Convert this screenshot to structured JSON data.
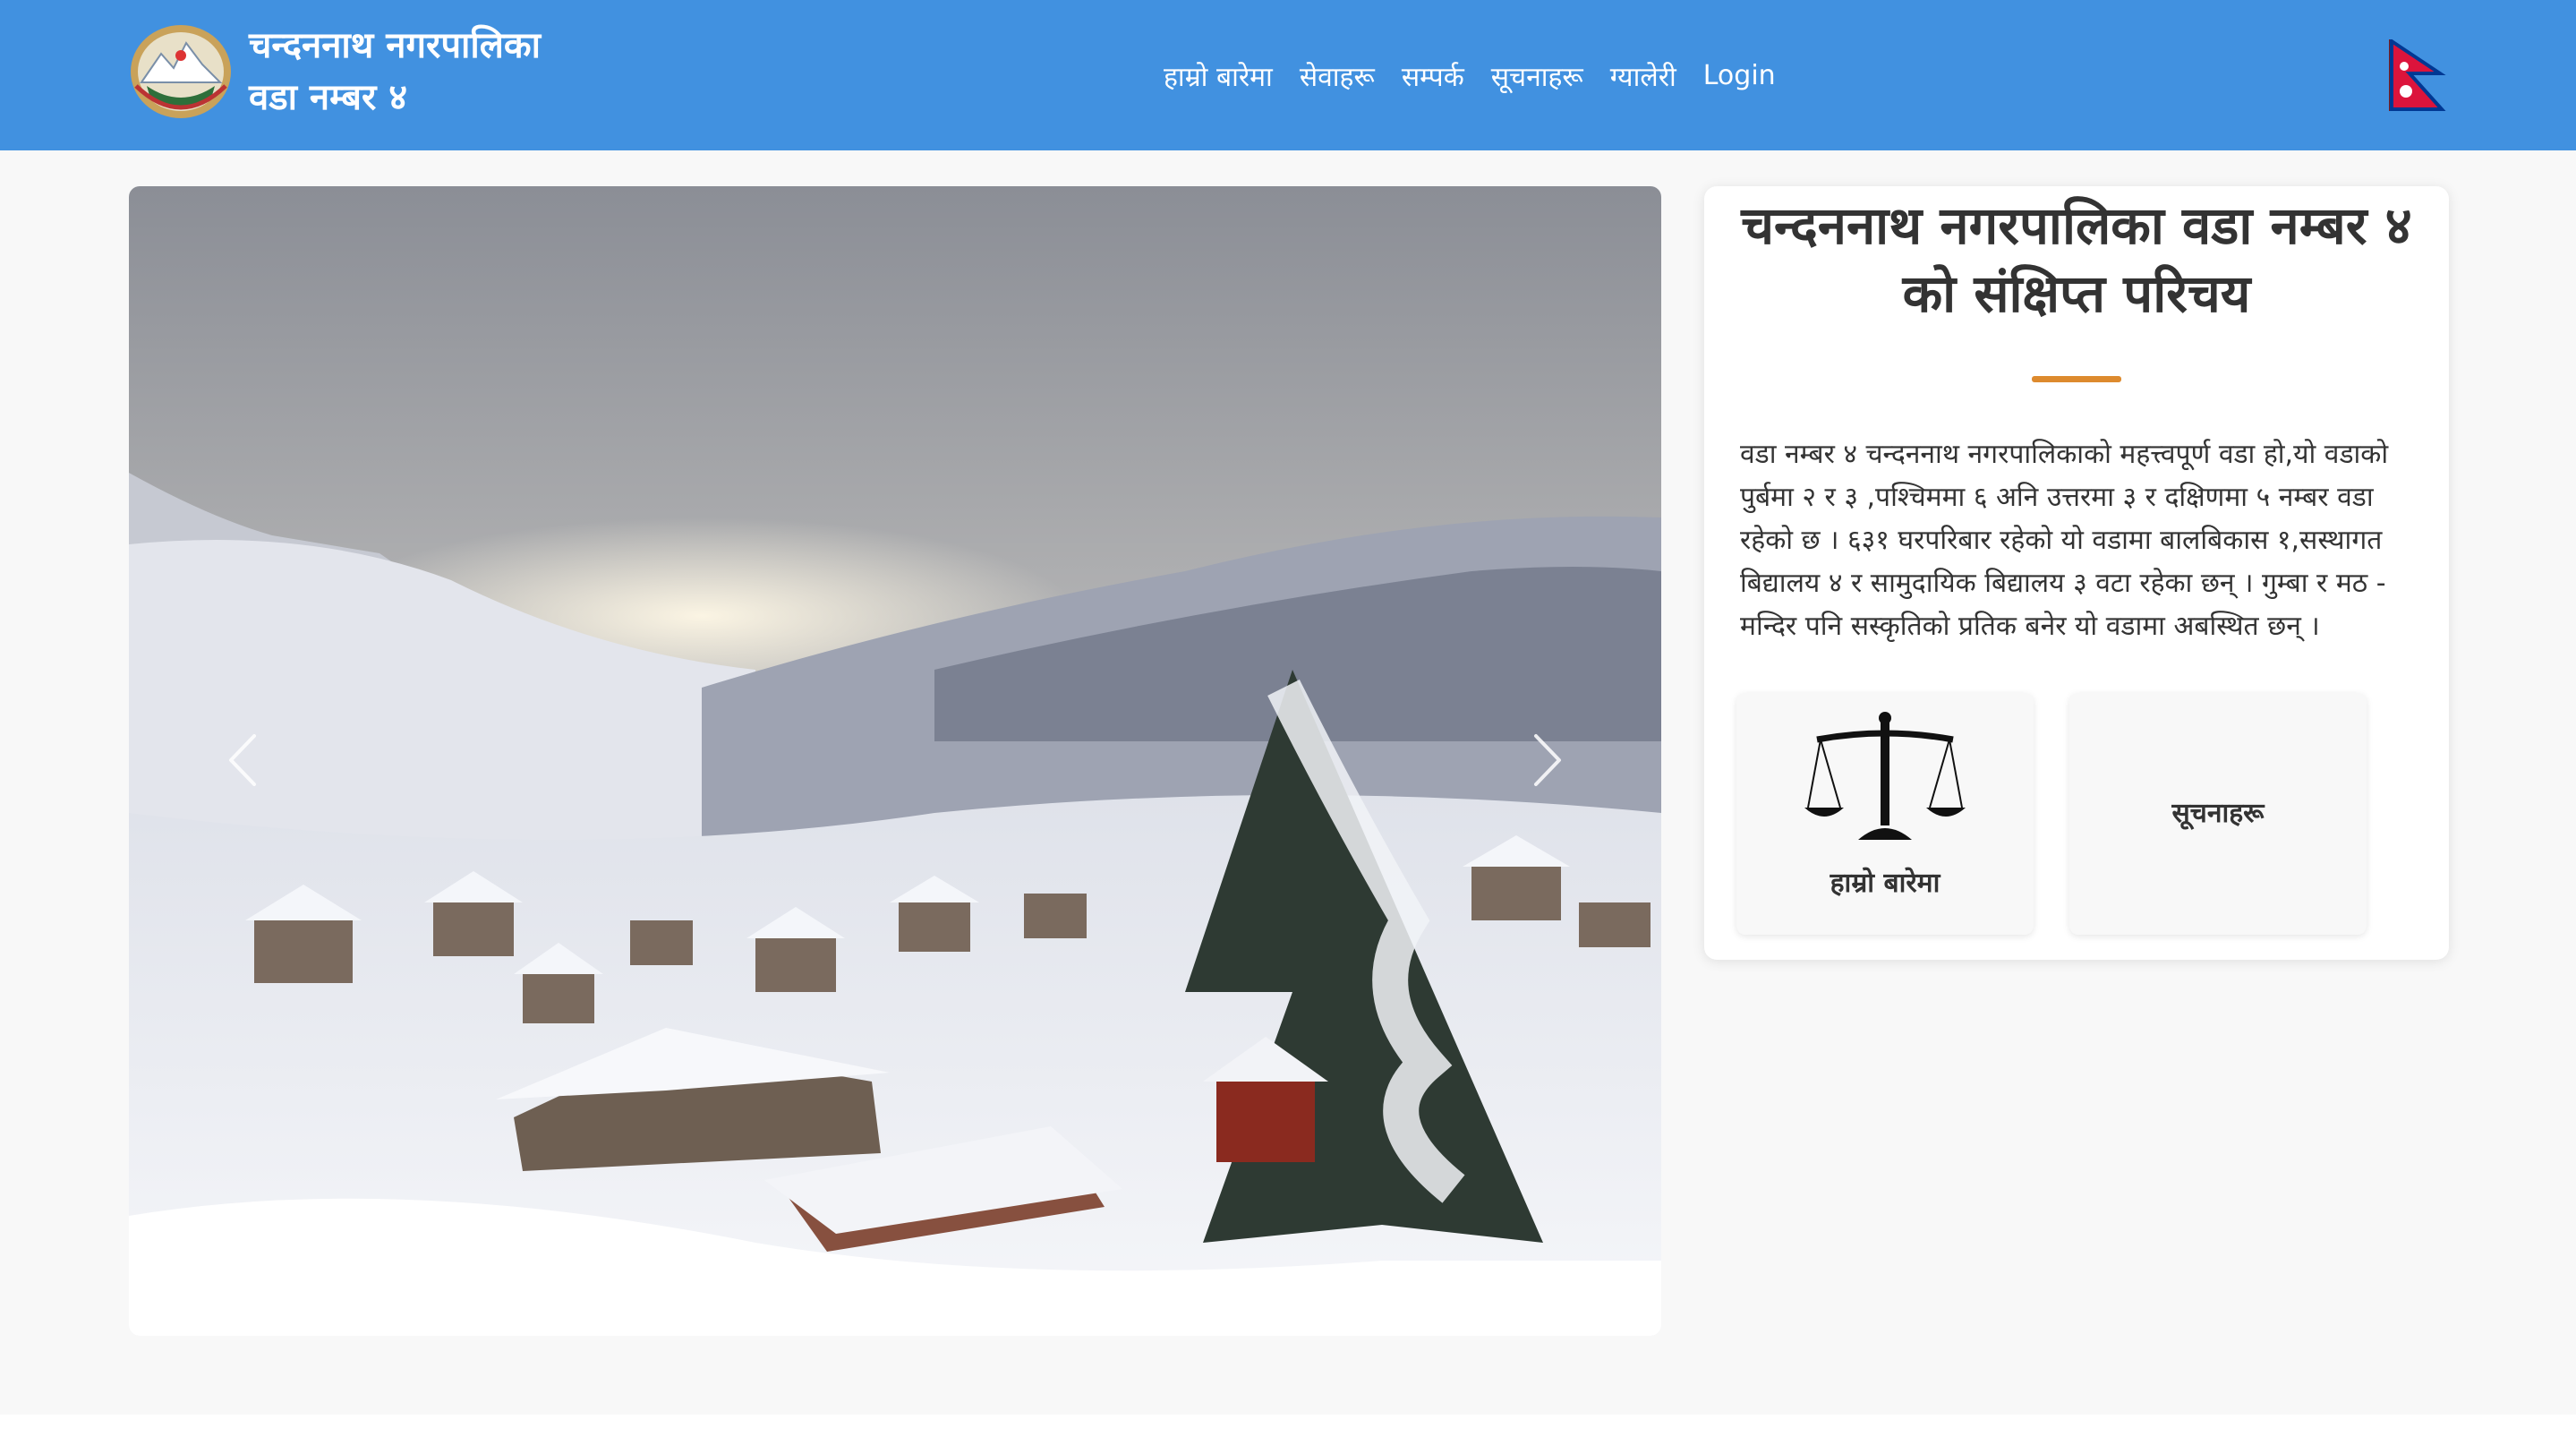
{
  "header": {
    "brand_line1": "चन्दननाथ नगरपालिका",
    "brand_line2": "वडा नम्बर ४",
    "nav": [
      {
        "label": "हाम्रो बारेमा"
      },
      {
        "label": "सेवाहरू"
      },
      {
        "label": "सम्पर्क"
      },
      {
        "label": "सूचनाहरू"
      },
      {
        "label": "ग्यालेरी"
      },
      {
        "label": "Login"
      }
    ]
  },
  "intro": {
    "title": "चन्दननाथ नगरपालिका वडा नम्बर ४ को संक्षिप्त परिचय",
    "body": "वडा नम्बर ४ चन्दननाथ नगरपालिकाको महत्त्वपूर्ण वडा हो,यो वडाको पुर्बमा २ र ३ ,पश्चिममा ६ अनि उत्तरमा ३ र दक्षिणमा ५ नम्बर वडा रहेको छ । ६३१ घरपरिबार रहेको यो वडामा बालबिकास १,सस्थागत बिद्यालय ४ र सामुदायिक बिद्यालय ३ वटा रहेका छन् । गुम्बा र मठ - मन्दिर पनि सस्कृतिको प्रतिक बनेर यो वडामा अबस्थित छन् ।",
    "tiles": [
      {
        "label": "हाम्रो बारेमा",
        "icon": "scales-of-justice-icon"
      },
      {
        "label": "सूचनाहरू"
      }
    ]
  },
  "colors": {
    "navbar": "#4191e0",
    "accent_divider": "#dd8a2e",
    "page_background": "#f8f8f8"
  }
}
